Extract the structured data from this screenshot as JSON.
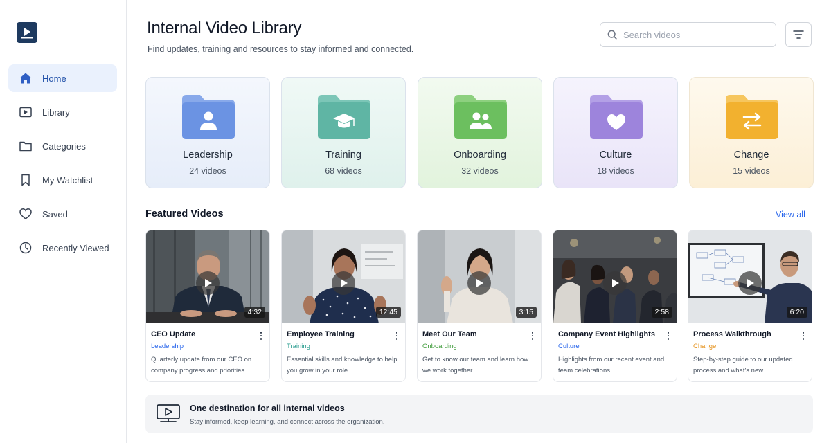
{
  "app": {
    "logo_icon": "play-video-logo-icon",
    "brand_color": "#1e3a5f",
    "accent_color": "#2563eb"
  },
  "sidebar": {
    "items": [
      {
        "label": "Home",
        "icon": "home-icon",
        "active": true
      },
      {
        "label": "Library",
        "icon": "play-square-icon",
        "active": false
      },
      {
        "label": "Categories",
        "icon": "folder-icon",
        "active": false
      },
      {
        "label": "My Watchlist",
        "icon": "bookmark-icon",
        "active": false
      },
      {
        "label": "Saved",
        "icon": "heart-icon",
        "active": false
      },
      {
        "label": "Recently Viewed",
        "icon": "clock-icon",
        "active": false
      }
    ]
  },
  "header": {
    "title": "Internal Video Library",
    "subtitle": "Find updates, training and resources to stay informed and connected.",
    "search_placeholder": "Search videos",
    "filter_icon": "filter-icon"
  },
  "categories": [
    {
      "name": "Leadership",
      "count": "24 videos",
      "icon": "person-icon",
      "color": "#6b93e3"
    },
    {
      "name": "Training",
      "count": "68 videos",
      "icon": "graduation-cap-icon",
      "color": "#5fb5a4"
    },
    {
      "name": "Onboarding",
      "count": "32 videos",
      "icon": "people-icon",
      "color": "#6cbf5f"
    },
    {
      "name": "Culture",
      "count": "18 videos",
      "icon": "heart-icon",
      "color": "#9d84dc"
    },
    {
      "name": "Change",
      "count": "15 videos",
      "icon": "arrows-swap-icon",
      "color": "#f2b12f"
    }
  ],
  "featured": {
    "title": "Featured Videos",
    "view_all": "View all",
    "videos": [
      {
        "title": "CEO Update",
        "tag": "Leadership",
        "tag_color": "#2563eb",
        "duration": "4:32",
        "description": "Quarterly update from our CEO on company progress and priorities."
      },
      {
        "title": "Employee Training",
        "tag": "Training",
        "tag_color": "#2a9d8f",
        "duration": "12:45",
        "description": "Essential skills and knowledge to help you grow in your role."
      },
      {
        "title": "Meet Our Team",
        "tag": "Onboarding",
        "tag_color": "#3f9b3a",
        "duration": "3:15",
        "description": "Get to know our team and learn how we work together."
      },
      {
        "title": "Company Event Highlights",
        "tag": "Culture",
        "tag_color": "#2563eb",
        "duration": "2:58",
        "description": "Highlights from our recent event and team celebrations."
      },
      {
        "title": "Process Walkthrough",
        "tag": "Change",
        "tag_color": "#e5921c",
        "duration": "6:20",
        "description": "Step-by-step guide to our updated process and what's new."
      }
    ]
  },
  "banner": {
    "icon": "monitor-play-icon",
    "title": "One destination for all internal videos",
    "subtitle": "Stay informed, keep learning, and connect across the organization."
  }
}
